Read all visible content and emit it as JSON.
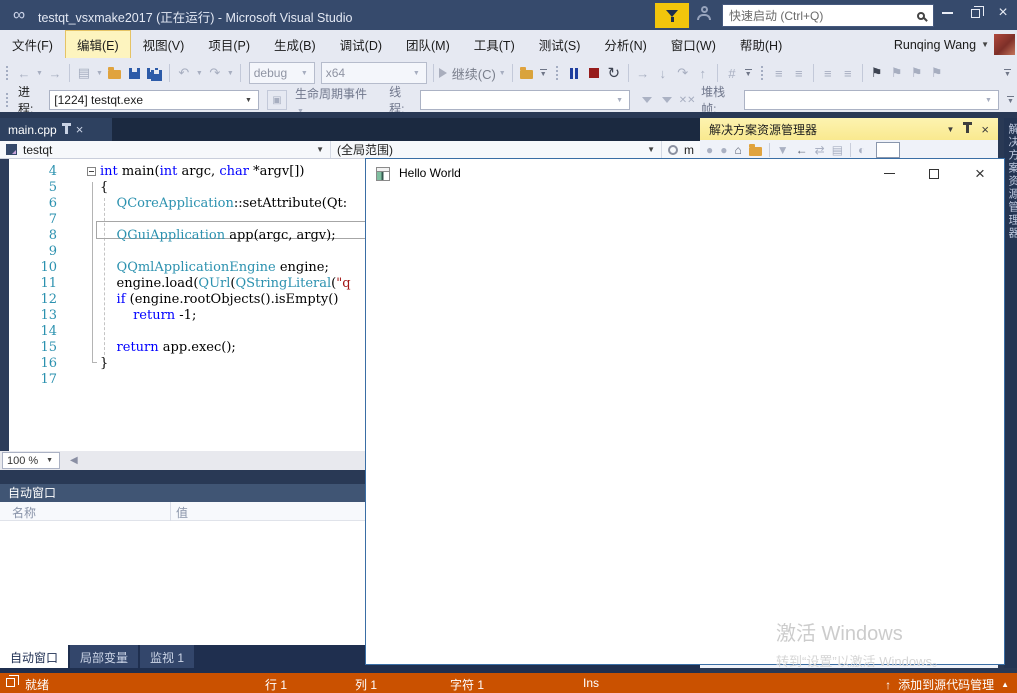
{
  "titlebar": {
    "title": "testqt_vsxmake2017 (正在运行) - Microsoft Visual Studio",
    "search_placeholder": "快速启动 (Ctrl+Q)",
    "user_name": "Runqing Wang"
  },
  "menubar": {
    "items": [
      "文件(F)",
      "编辑(E)",
      "视图(V)",
      "项目(P)",
      "生成(B)",
      "调试(D)",
      "团队(M)",
      "工具(T)",
      "测试(S)",
      "分析(N)",
      "窗口(W)",
      "帮助(H)"
    ],
    "active_item": "编辑(E)"
  },
  "toolbar": {
    "config_value": "debug",
    "platform_value": "x64",
    "continue_label": "继续(C)"
  },
  "debug_location_bar": {
    "process_label": "进程:",
    "process_value": "[1224] testqt.exe",
    "lifecycle_label": "生命周期事件",
    "thread_label": "线程:",
    "stack_label": "堆栈帧:"
  },
  "editor": {
    "tab_title": "main.cpp",
    "nav_project": "testqt",
    "nav_scope": "(全局范围)",
    "nav_member": "m",
    "zoom_value": "100 %",
    "code_lines": [
      {
        "num": "4",
        "fold": true,
        "segments": [
          [
            "k",
            "int"
          ],
          [
            "p",
            " main("
          ],
          [
            "k",
            "int"
          ],
          [
            "p",
            " argc, "
          ],
          [
            "k",
            "char"
          ],
          [
            "p",
            " *argv[])"
          ]
        ]
      },
      {
        "num": "5",
        "segments": [
          [
            "p",
            "{"
          ]
        ]
      },
      {
        "num": "6",
        "segments": [
          [
            "p",
            "    "
          ],
          [
            "t",
            "QCoreApplication"
          ],
          [
            "p",
            "::setAttribute(Qt:"
          ]
        ]
      },
      {
        "num": "7",
        "segments": []
      },
      {
        "num": "8",
        "boxed": true,
        "segments": [
          [
            "p",
            "    "
          ],
          [
            "t",
            "QGuiApplication"
          ],
          [
            "p",
            " app(argc, argv);"
          ]
        ]
      },
      {
        "num": "9",
        "segments": []
      },
      {
        "num": "10",
        "segments": [
          [
            "p",
            "    "
          ],
          [
            "t",
            "QQmlApplicationEngine"
          ],
          [
            "p",
            " engine;"
          ]
        ]
      },
      {
        "num": "11",
        "segments": [
          [
            "p",
            "    engine.load("
          ],
          [
            "t",
            "QUrl"
          ],
          [
            "p",
            "("
          ],
          [
            "t",
            "QStringLiteral"
          ],
          [
            "p",
            "("
          ],
          [
            "s",
            "\"q"
          ]
        ]
      },
      {
        "num": "12",
        "segments": [
          [
            "p",
            "    "
          ],
          [
            "k",
            "if"
          ],
          [
            "p",
            " (engine.rootObjects().isEmpty()"
          ]
        ]
      },
      {
        "num": "13",
        "segments": [
          [
            "p",
            "        "
          ],
          [
            "k",
            "return"
          ],
          [
            "p",
            " -1;"
          ]
        ]
      },
      {
        "num": "14",
        "segments": []
      },
      {
        "num": "15",
        "segments": [
          [
            "p",
            "    "
          ],
          [
            "k",
            "return"
          ],
          [
            "p",
            " app.exec();"
          ]
        ]
      },
      {
        "num": "16",
        "segments": [
          [
            "p",
            "}"
          ]
        ]
      },
      {
        "num": "17",
        "segments": []
      }
    ]
  },
  "autos_panel": {
    "title": "自动窗口",
    "columns": [
      "名称",
      "值"
    ],
    "tabs": [
      "自动窗口",
      "局部变量",
      "监视 1"
    ],
    "active_tab": "自动窗口"
  },
  "solution_explorer": {
    "title": "解决方案资源管理器",
    "side_tab_label": "解决方案资源管理器"
  },
  "hello_window": {
    "title": "Hello World",
    "watermark_line1": "激活 Windows",
    "watermark_line2": "转到“设置”以激活 Windows。"
  },
  "statusbar": {
    "ready": "就绪",
    "line": "行 1",
    "column": "列 1",
    "character": "字符 1",
    "insert_mode": "Ins",
    "source_control": "添加到源代码管理"
  },
  "colors": {
    "status_debug_orange": "#CA5100",
    "titlebar_navy": "#364A6C",
    "active_panel_gold": "#FDF0A9",
    "accent_yellow": "#F2C50C",
    "keyword_blue": "#0000FF",
    "type_teal": "#2B91AF",
    "string_red": "#A31515",
    "env_blue": "#293955"
  }
}
